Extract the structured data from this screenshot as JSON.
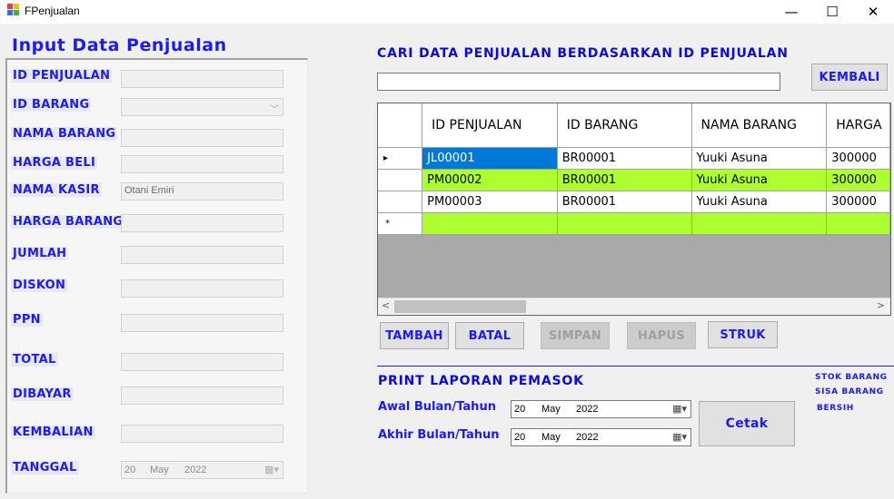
{
  "window": {
    "title": "FPenjualan",
    "minimize": "—",
    "maximize": "☐",
    "close": "✕"
  },
  "form": {
    "heading": "Input Data Penjualan",
    "fields": {
      "id_penjualan": {
        "label": "ID PENJUALAN",
        "value": ""
      },
      "id_barang": {
        "label": "ID BARANG",
        "value": ""
      },
      "nama_barang": {
        "label": "NAMA BARANG",
        "value": ""
      },
      "harga_beli": {
        "label": "HARGA BELI",
        "value": ""
      },
      "nama_kasir": {
        "label": "NAMA KASIR",
        "value": "Otani Emiri"
      },
      "harga_barang": {
        "label": "HARGA BARANG",
        "value": ""
      },
      "jumlah": {
        "label": "JUMLAH",
        "value": ""
      },
      "diskon": {
        "label": "DISKON",
        "value": ""
      },
      "ppn": {
        "label": "PPN",
        "value": ""
      },
      "total": {
        "label": "TOTAL",
        "value": ""
      },
      "dibayar": {
        "label": "DIBAYAR",
        "value": ""
      },
      "kembalian": {
        "label": "KEMBALIAN",
        "value": ""
      },
      "tanggal": {
        "label": "TANGGAL",
        "day": "20",
        "month": "May",
        "year": "2022"
      }
    }
  },
  "search": {
    "heading": "CARI DATA PENJUALAN BERDASARKAN ID PENJUALAN",
    "value": "",
    "back_button": "KEMBALI"
  },
  "grid": {
    "columns": [
      "ID PENJUALAN",
      "ID BARANG",
      "NAMA BARANG",
      "HARGA"
    ],
    "rows": [
      {
        "id_penjualan": "JL00001",
        "id_barang": "BR00001",
        "nama_barang": "Yuuki Asuna",
        "harga": "300000"
      },
      {
        "id_penjualan": "PM00002",
        "id_barang": "BR00001",
        "nama_barang": "Yuuki Asuna",
        "harga": "300000"
      },
      {
        "id_penjualan": "PM00003",
        "id_barang": "BR00001",
        "nama_barang": "Yuuki Asuna",
        "harga": "300000"
      }
    ],
    "current_row_marker": "▸",
    "new_row_marker": "*"
  },
  "actions": {
    "tambah": "TAMBAH",
    "batal": "BATAL",
    "simpan": "SIMPAN",
    "hapus": "HAPUS",
    "struk": "STRUK"
  },
  "report": {
    "heading": "PRINT LAPORAN PEMASOK",
    "awal_label": "Awal Bulan/Tahun",
    "awal": {
      "day": "20",
      "month": "May",
      "year": "2022"
    },
    "akhir_label": "Akhir Bulan/Tahun",
    "akhir": {
      "day": "20",
      "month": "May",
      "year": "2022"
    },
    "cetak": "Cetak"
  },
  "side_labels": {
    "stok": "STOK BARANG",
    "sisa": "SISA BARANG",
    "bersih": "BERSIH"
  },
  "colors": {
    "label_blue": "#1a1aff",
    "row_green": "#adff2f",
    "selected": "#0078d7"
  }
}
